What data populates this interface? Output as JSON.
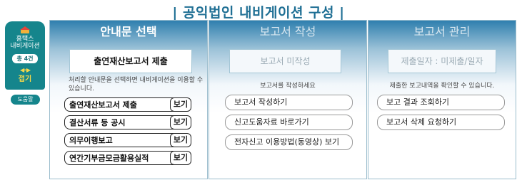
{
  "title": "공익법인 내비게이션 구성",
  "nav": {
    "title_line1": "홈택스",
    "title_line2": "내비게이션",
    "count": "총 4건",
    "fold": "접기",
    "help": "도움말"
  },
  "panels": [
    {
      "header": "안내문 선택",
      "box": "출연재산보고서 제출",
      "desc": "처리할 안내문을 선택하면 내비게이션을 이용할 수 있습니다.",
      "items": [
        {
          "label": "출연재산보고서 제출",
          "action": "보기"
        },
        {
          "label": "결산서류 등 공시",
          "action": "보기"
        },
        {
          "label": "의무이행보고",
          "action": "보기"
        },
        {
          "label": "연간기부금모금활용실적",
          "action": "보기"
        }
      ]
    },
    {
      "header": "보고서 작성",
      "box": "보고서 미작성",
      "desc": "보고서를 작성하세요",
      "links": [
        "보고서 작성하기",
        "신고도움자료 바로가기",
        "전자신고 이용방법(동영상) 보기"
      ]
    },
    {
      "header": "보고서 관리",
      "box": "제출일자 : 미제출/일자",
      "desc": "제출한 보고내역을 확인할 수 있습니다.",
      "links": [
        "보고 결과 조회하기",
        "보고서 삭제 요청하기"
      ]
    }
  ]
}
